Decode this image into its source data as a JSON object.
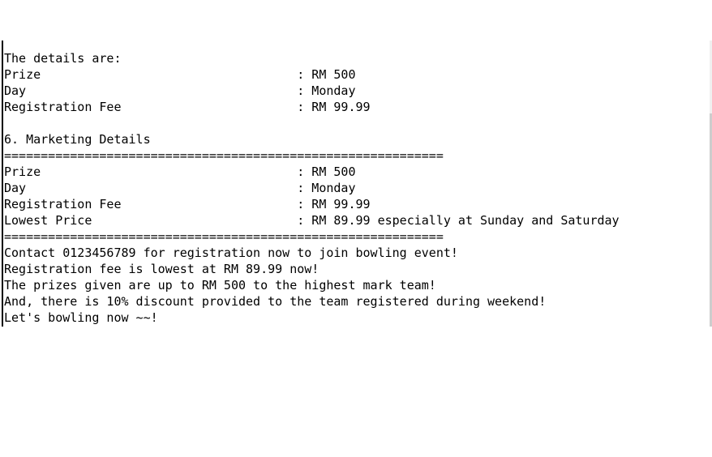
{
  "console": {
    "lines": [
      "The details are:",
      "Prize                                   : RM 500",
      "Day                                     : Monday",
      "Registration Fee                        : RM 99.99",
      "",
      "6. Marketing Details",
      "============================================================",
      "Prize                                   : RM 500",
      "Day                                     : Monday",
      "Registration Fee                        : RM 99.99",
      "Lowest Price                            : RM 89.99 especially at Sunday and Saturday",
      "============================================================",
      "Contact 0123456789 for registration now to join bowling event!",
      "Registration fee is lowest at RM 89.99 now!",
      "The prizes given are up to RM 500 to the highest mark team!",
      "And, there is 10% discount provided to the team registered during weekend!",
      "Let's bowling now ~~!"
    ]
  }
}
